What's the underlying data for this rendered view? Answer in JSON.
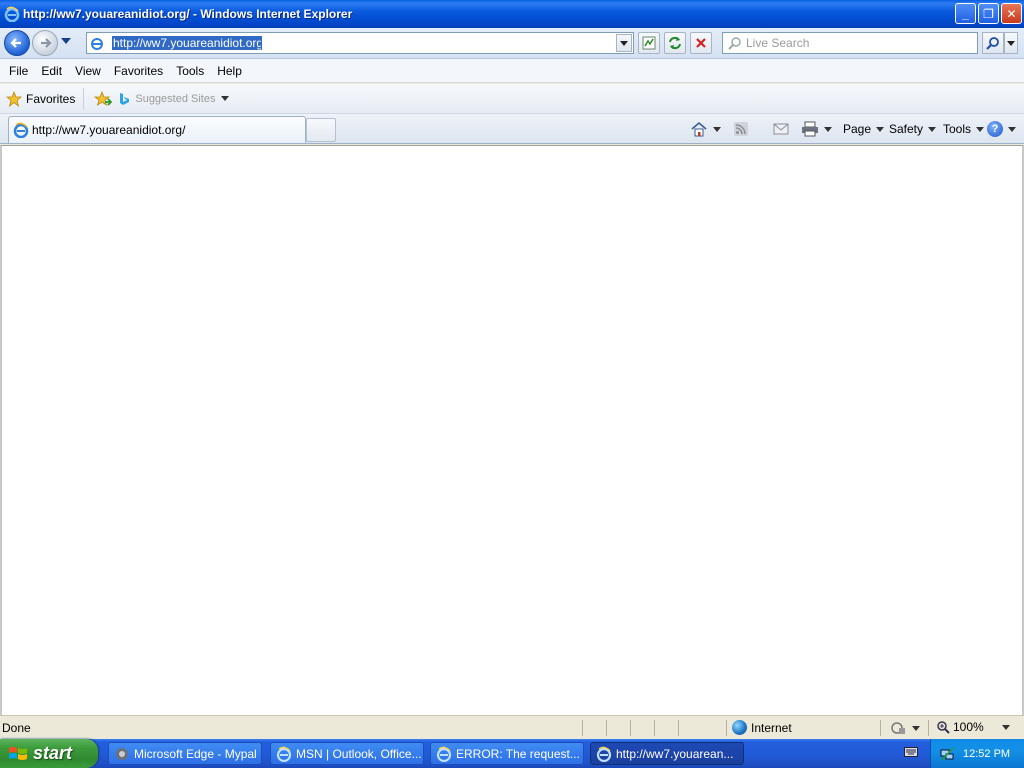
{
  "window": {
    "title": "http://ww7.youareanidiot.org/ - Windows Internet Explorer",
    "minimize_label": "_",
    "restore_label": "❐",
    "close_label": "✕"
  },
  "address_bar": {
    "url": "http://ww7.youareanidiot.org/"
  },
  "search": {
    "placeholder": "Live Search"
  },
  "menu": {
    "items": [
      "File",
      "Edit",
      "View",
      "Favorites",
      "Tools",
      "Help"
    ]
  },
  "favorites_bar": {
    "favorites_label": "Favorites",
    "suggested_sites_label": "Suggested Sites"
  },
  "tabs": {
    "active_tab_label": "http://ww7.youareanidiot.org/"
  },
  "command_bar": {
    "page_label": "Page",
    "safety_label": "Safety",
    "tools_label": "Tools",
    "help_glyph": "?"
  },
  "status_bar": {
    "status_text": "Done",
    "zone_label": "Internet",
    "zoom_level": "100%"
  },
  "taskbar": {
    "start_label": "start",
    "tasks": [
      {
        "label": "Microsoft Edge - Mypal",
        "icon": "mypal-icon"
      },
      {
        "label": "MSN | Outlook, Office...",
        "icon": "ie-icon"
      },
      {
        "label": "ERROR: The request...",
        "icon": "ie-icon"
      },
      {
        "label": "http://ww7.youarean...",
        "icon": "ie-icon",
        "active": true
      }
    ],
    "clock": "12:52 PM"
  },
  "colors": {
    "title_bar": "#0a5adf",
    "taskbar": "#225bd8",
    "start_button": "#3c9c3c",
    "url_selection": "#316ac5"
  }
}
